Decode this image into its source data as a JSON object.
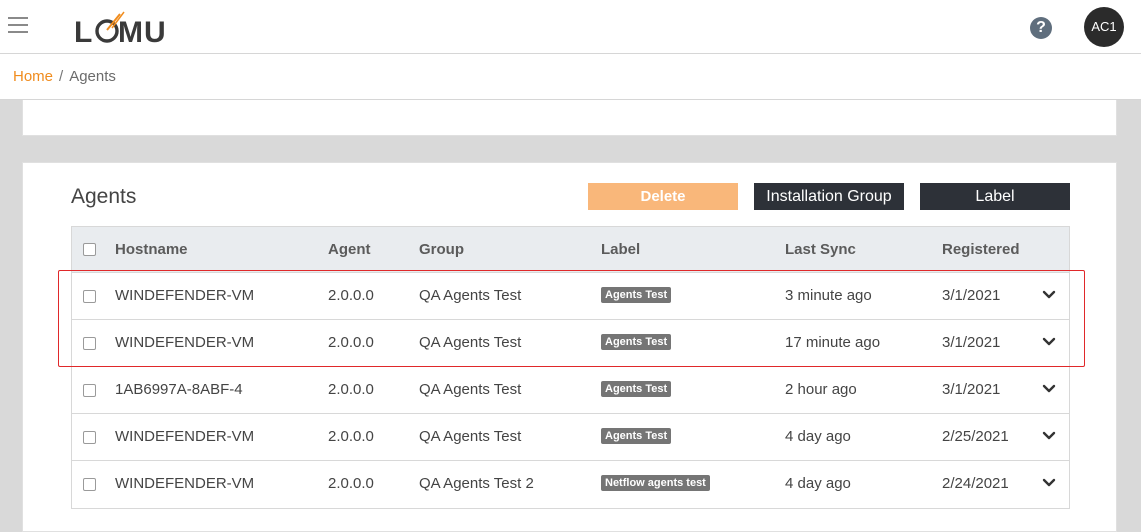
{
  "header": {
    "logo_text": "LUMU",
    "avatar_text": "AC1",
    "help_symbol": "?",
    "icons": [
      "hamburger-icon",
      "help-icon"
    ]
  },
  "breadcrumb": {
    "home": "Home",
    "separator": "/",
    "current": "Agents"
  },
  "agents": {
    "title": "Agents",
    "buttons": {
      "delete": "Delete",
      "installation_group": "Installation Group",
      "label": "Label"
    },
    "columns": {
      "hostname": "Hostname",
      "agent": "Agent",
      "group": "Group",
      "label": "Label",
      "last_sync": "Last Sync",
      "registered": "Registered"
    },
    "rows": [
      {
        "hostname": "WINDEFENDER-VM",
        "agent": "2.0.0.0",
        "group": "QA Agents Test",
        "label": "Agents Test",
        "last_sync": "3 minute ago",
        "registered": "3/1/2021"
      },
      {
        "hostname": "WINDEFENDER-VM",
        "agent": "2.0.0.0",
        "group": "QA Agents Test",
        "label": "Agents Test",
        "last_sync": "17 minute ago",
        "registered": "3/1/2021"
      },
      {
        "hostname": "1AB6997A-8ABF-4",
        "agent": "2.0.0.0",
        "group": "QA Agents Test",
        "label": "Agents Test",
        "last_sync": "2 hour ago",
        "registered": "3/1/2021"
      },
      {
        "hostname": "WINDEFENDER-VM",
        "agent": "2.0.0.0",
        "group": "QA Agents Test",
        "label": "Agents Test",
        "last_sync": "4 day ago",
        "registered": "2/25/2021"
      },
      {
        "hostname": "WINDEFENDER-VM",
        "agent": "2.0.0.0",
        "group": "QA Agents Test 2",
        "label": "Netflow agents test",
        "last_sync": "4 day ago",
        "registered": "2/24/2021"
      }
    ]
  },
  "colors": {
    "accent": "#f08c1e",
    "dark_button": "#2d3138",
    "delete_button": "#f9b77a",
    "badge": "#757575",
    "highlight": "#e0282a"
  }
}
